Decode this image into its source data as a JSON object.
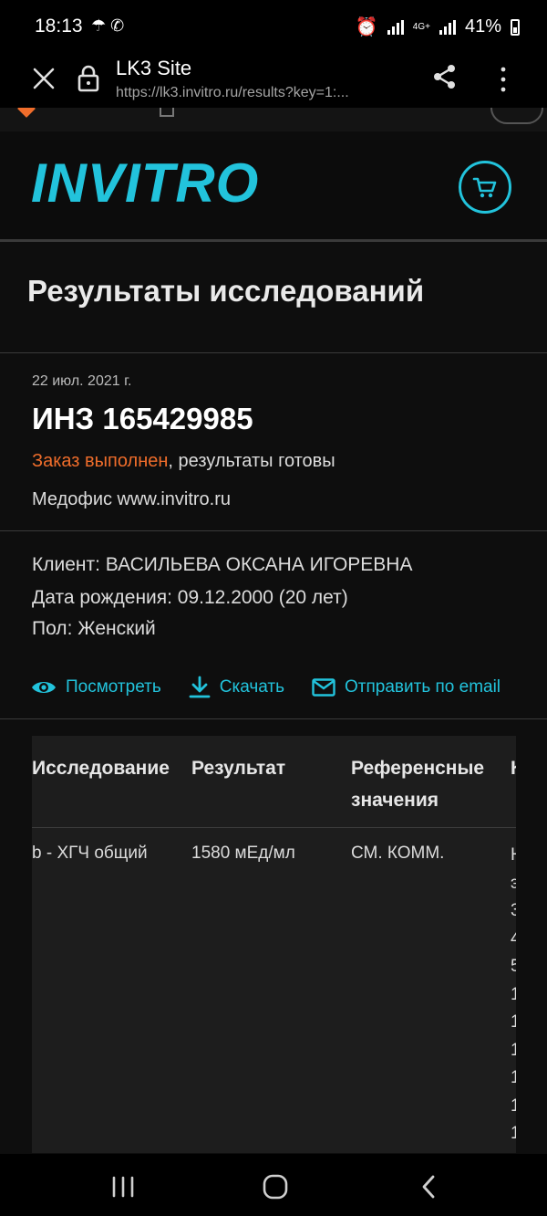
{
  "status_bar": {
    "time": "18:13",
    "network": "4G+",
    "battery": "41%"
  },
  "browser": {
    "title": "LK3 Site",
    "url": "https://lk3.invitro.ru/results?key=1:..."
  },
  "header": {
    "logo": "INVITRO"
  },
  "page": {
    "title": "Результаты исследований"
  },
  "order": {
    "date": "22 июл. 2021 г.",
    "number": "ИНЗ 165429985",
    "status_done": "Заказ выполнен",
    "status_rest": ", результаты готовы",
    "office": "Медофис www.invitro.ru"
  },
  "client": {
    "name": "Клиент: ВАСИЛЬЕВА ОКСАНА ИГОРЕВНА",
    "birth": "Дата рождения: 09.12.2000 (20 лет)",
    "gender": "Пол: Женский"
  },
  "actions": {
    "view": "Посмотреть",
    "download": "Скачать",
    "email": "Отправить по email"
  },
  "table": {
    "headers": [
      "Исследование",
      "Результат",
      "Референсные значения",
      "К"
    ],
    "rows": [
      {
        "test": "b - ХГЧ общий",
        "result": "1580 мЕд/мл",
        "ref": "СМ. КОММ."
      }
    ],
    "cut_column_chars": [
      "Н",
      "э",
      "3",
      "4",
      "5",
      "1",
      "1",
      "1",
      "1",
      "1",
      "1"
    ]
  },
  "colors": {
    "accent": "#22c3dc",
    "orange": "#ef6d2b",
    "background": "#0e0e0e"
  }
}
